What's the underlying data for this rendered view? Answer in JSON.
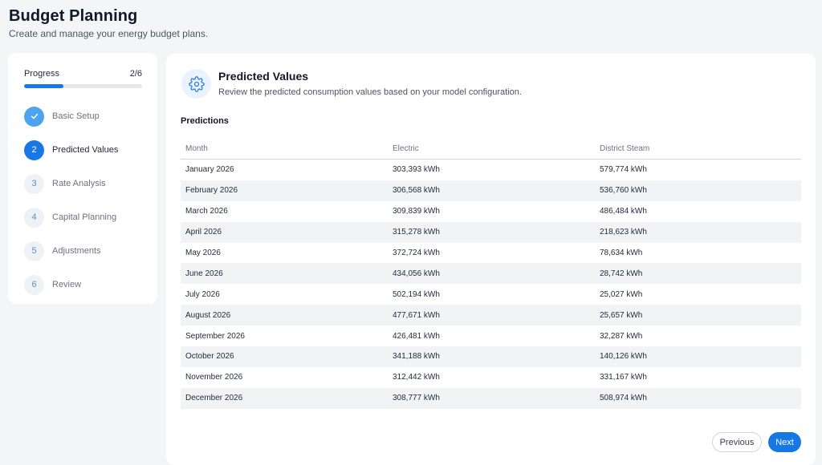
{
  "header": {
    "title": "Budget Planning",
    "subtitle": "Create and manage your energy budget plans."
  },
  "sidebar": {
    "progress_label": "Progress",
    "progress_count": "2/6",
    "progress_fraction": 0.33,
    "steps": [
      {
        "marker": "",
        "label": "Basic Setup",
        "state": "done"
      },
      {
        "marker": "2",
        "label": "Predicted Values",
        "state": "active"
      },
      {
        "marker": "3",
        "label": "Rate Analysis",
        "state": "pending"
      },
      {
        "marker": "4",
        "label": "Capital Planning",
        "state": "pending"
      },
      {
        "marker": "5",
        "label": "Adjustments",
        "state": "pending"
      },
      {
        "marker": "6",
        "label": "Review",
        "state": "pending"
      }
    ]
  },
  "main": {
    "icon": "gear-icon",
    "title": "Predicted Values",
    "description": "Review the predicted consumption values based on your model configuration.",
    "section_title": "Predictions",
    "columns": [
      "Month",
      "Electric",
      "District Steam"
    ],
    "rows": [
      [
        "January 2026",
        "303,393 kWh",
        "579,774 kWh"
      ],
      [
        "February 2026",
        "306,568 kWh",
        "536,760 kWh"
      ],
      [
        "March 2026",
        "309,839 kWh",
        "486,484 kWh"
      ],
      [
        "April 2026",
        "315,278 kWh",
        "218,623 kWh"
      ],
      [
        "May 2026",
        "372,724 kWh",
        "78,634 kWh"
      ],
      [
        "June 2026",
        "434,056 kWh",
        "28,742 kWh"
      ],
      [
        "July 2026",
        "502,194 kWh",
        "25,027 kWh"
      ],
      [
        "August 2026",
        "477,671 kWh",
        "25,657 kWh"
      ],
      [
        "September 2026",
        "426,481 kWh",
        "32,287 kWh"
      ],
      [
        "October 2026",
        "341,188 kWh",
        "140,126 kWh"
      ],
      [
        "November 2026",
        "312,442 kWh",
        "331,167 kWh"
      ],
      [
        "December 2026",
        "308,777 kWh",
        "508,974 kWh"
      ]
    ],
    "previous_label": "Previous",
    "next_label": "Next"
  },
  "colors": {
    "accent": "#1677e5",
    "done": "#4ca3ee",
    "background": "#f4f5f7"
  }
}
